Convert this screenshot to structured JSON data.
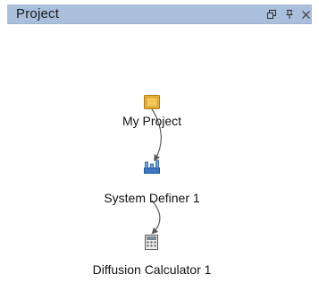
{
  "panel": {
    "title": "Project",
    "controls": [
      {
        "name": "restore-icon",
        "glyph": "restore"
      },
      {
        "name": "pin-icon",
        "glyph": "pin"
      },
      {
        "name": "close-icon",
        "glyph": "×"
      }
    ]
  },
  "tree": {
    "nodes": [
      {
        "label": "My Project",
        "icon": "folder-icon"
      },
      {
        "label": "System Definer 1",
        "icon": "system-definer-icon"
      },
      {
        "label": "Diffusion Calculator 1",
        "icon": "calculator-icon"
      }
    ]
  },
  "colors": {
    "titlebar": "#a9bfdb",
    "folder": "#e8b13a",
    "definer": "#3a78c2",
    "edge": "#5a5a5a"
  }
}
